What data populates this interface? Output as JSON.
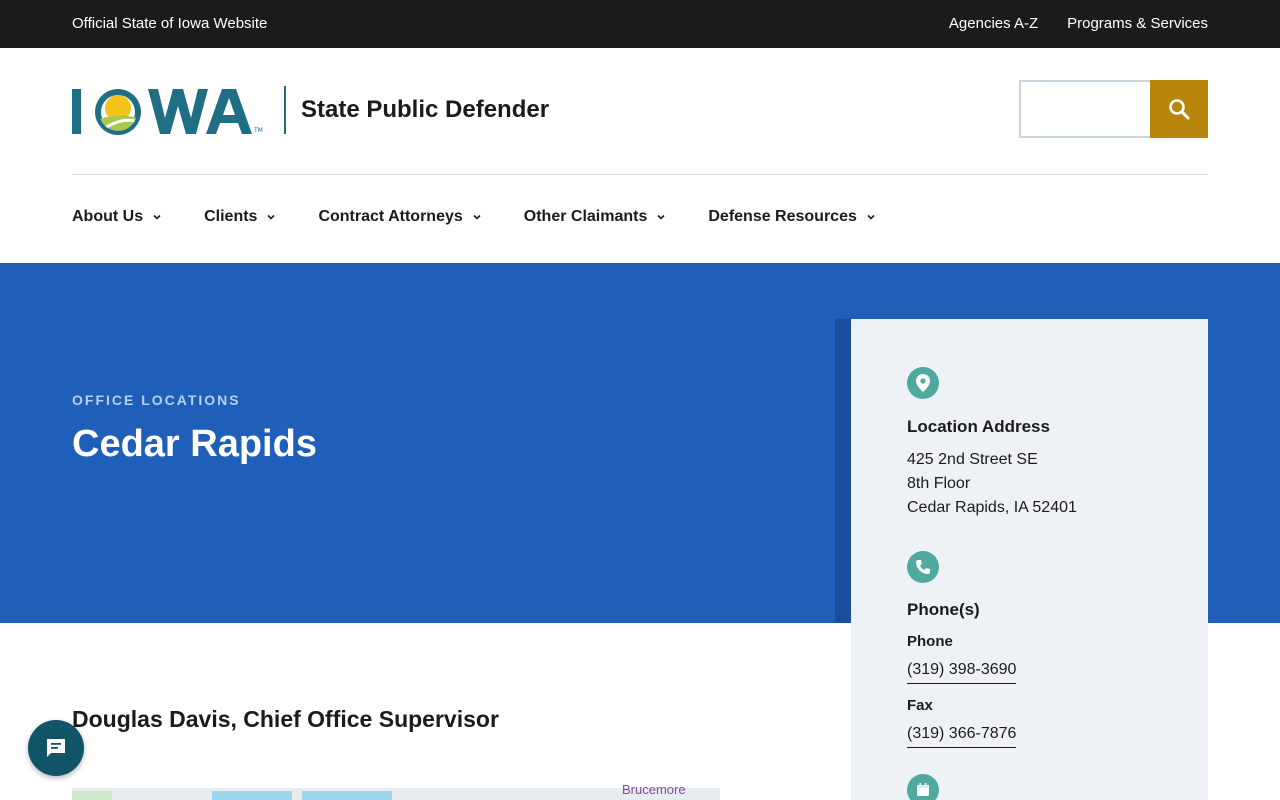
{
  "topbar": {
    "official": "Official State of Iowa Website",
    "links": [
      "Agencies A-Z",
      "Programs & Services"
    ]
  },
  "header": {
    "logo_text": "IOWA",
    "site_name": "State Public Defender",
    "search_placeholder": ""
  },
  "nav": {
    "items": [
      "About Us",
      "Clients",
      "Contract Attorneys",
      "Other Claimants",
      "Defense Resources"
    ]
  },
  "hero": {
    "eyebrow": "OFFICE LOCATIONS",
    "title": "Cedar Rapids"
  },
  "card": {
    "location_heading": "Location Address",
    "address_lines": [
      "425 2nd Street SE",
      "8th Floor",
      "Cedar Rapids, IA 52401"
    ],
    "phones_heading": "Phone(s)",
    "phone_label": "Phone",
    "phone_value": "(319) 398-3690",
    "fax_label": "Fax",
    "fax_value": "(319) 366-7876"
  },
  "main": {
    "supervisor": "Douglas Davis, Chief Office Supervisor",
    "map_label": "Brucemore"
  },
  "colors": {
    "topbar": "#1b1b1b",
    "hero": "#1f5fba",
    "search_button": "#b8860b",
    "icon_circle": "#4fa99e",
    "chat": "#115468"
  },
  "icons": {
    "search": "search-icon",
    "location": "map-pin-icon",
    "phone": "phone-icon",
    "calendar": "calendar-icon",
    "chat": "chat-icon"
  }
}
